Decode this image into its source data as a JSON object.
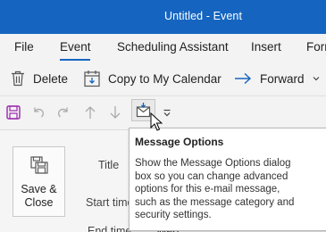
{
  "window": {
    "title": "Untitled  -  Event"
  },
  "menu": {
    "tabs": [
      "File",
      "Event",
      "Scheduling Assistant",
      "Insert",
      "Forr"
    ],
    "active_tab": "Event"
  },
  "ribbon": {
    "delete_label": "Delete",
    "copy_label": "Copy to My Calendar",
    "forward_label": "Forward"
  },
  "qat": {
    "icons": [
      "save-icon",
      "undo-icon",
      "redo-icon",
      "up-arrow-icon",
      "down-arrow-icon",
      "message-options-icon",
      "customize-dropdown-icon"
    ]
  },
  "form": {
    "save_close_label_line1": "Save &",
    "save_close_label_line2": "Close",
    "title_label": "Title",
    "start_time_label": "Start time",
    "end_time_label": "End time",
    "end_time_value_partial": "Wed"
  },
  "tooltip": {
    "title": "Message Options",
    "lines": [
      "Show the Message Options dialog",
      "box so you can change advanced",
      "options for this e-mail message,",
      "such as the message category and",
      "security settings."
    ]
  },
  "colors": {
    "titlebar": "#1565c0",
    "accent": "#1565c0",
    "save_icon": "#9c27b0"
  }
}
